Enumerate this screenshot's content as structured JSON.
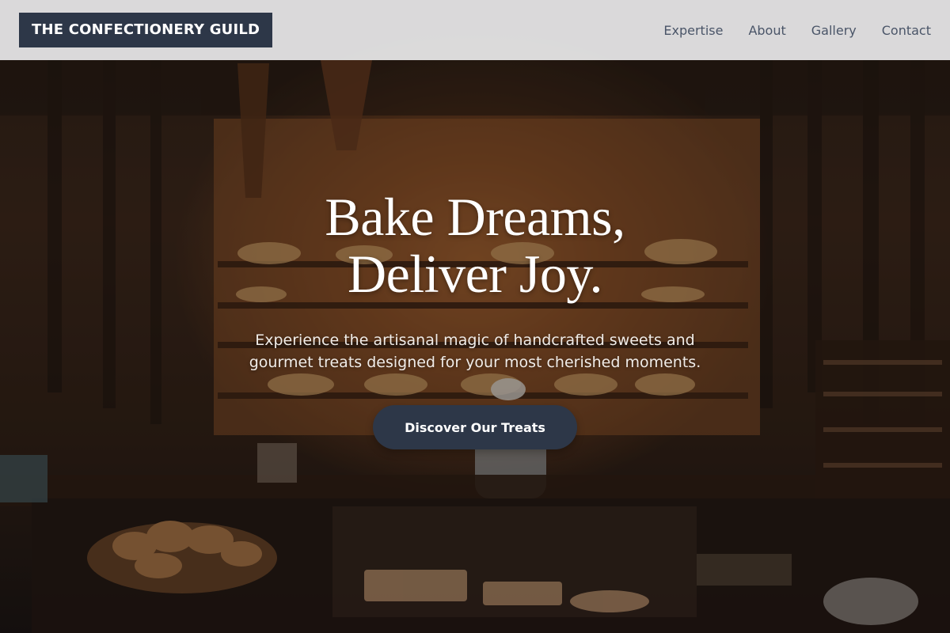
{
  "header": {
    "logo_text": "THE CONFECTIONERY GUILD",
    "nav": [
      {
        "label": "Expertise"
      },
      {
        "label": "About"
      },
      {
        "label": "Gallery"
      },
      {
        "label": "Contact"
      }
    ]
  },
  "hero": {
    "title_line1": "Bake Dreams,",
    "title_line2": "Deliver Joy.",
    "subtitle_line1": "Experience the artisanal magic of handcrafted sweets and",
    "subtitle_line2": "gourmet treats designed for your most cherished moments.",
    "cta_label": "Discover Our Treats"
  },
  "colors": {
    "header_bg": "#e8e8ea",
    "logo_bg": "#2d3748",
    "nav_text": "#4a5568",
    "cta_bg": "#2d3748",
    "hero_text": "#ffffff"
  }
}
